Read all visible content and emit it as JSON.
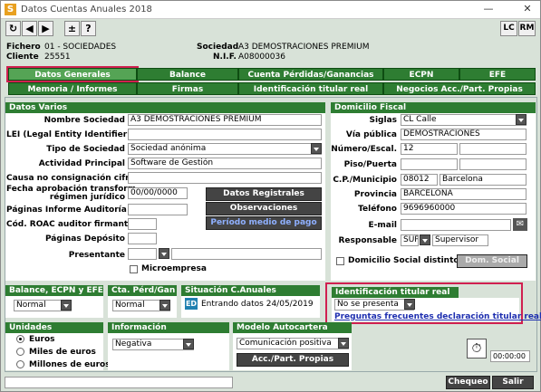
{
  "window": {
    "title": "Datos Cuentas Anuales 2018",
    "app_icon": "S",
    "lc": "LC",
    "rm": "RM"
  },
  "header": {
    "fichero_label": "Fichero",
    "fichero_value": "01 - SOCIEDADES",
    "cliente_label": "Cliente",
    "cliente_value": "25551",
    "sociedad_label": "Sociedad",
    "sociedad_value": "A3 DEMOSTRACIONES PREMIUM",
    "nif_label": "N.I.F.",
    "nif_value": "A08000036"
  },
  "tabs_row1": [
    "Datos Generales",
    "Balance",
    "Cuenta Pérdidas/Ganancias",
    "ECPN",
    "EFE"
  ],
  "tabs_row2": [
    "Memoria / Informes",
    "Firmas",
    "Identificación titular real",
    "Negocios Acc./Part. Propias"
  ],
  "datos_varios": {
    "title": "Datos Varios",
    "nombre_label": "Nombre Sociedad",
    "nombre_value": "A3 DEMOSTRACIONES PREMIUM",
    "lei_label": "LEI (Legal Entity Identifier)",
    "tipo_label": "Tipo de Sociedad",
    "tipo_value": "Sociedad anónima",
    "actividad_label": "Actividad Principal",
    "actividad_value": "Software de Gestión",
    "causa_label": "Causa no consignación cifras",
    "fecha_label1": "Fecha aprobación transform.",
    "fecha_label2": "régimen jurídico",
    "fecha_value": "00/00/0000",
    "paginas_inf_label": "Páginas Informe Auditoría",
    "roac_label": "Cód. ROAC auditor firmante",
    "paginas_dep_label": "Páginas Depósito",
    "presentante_label": "Presentante",
    "microempresa_label": "Microempresa",
    "btn_datos_registrales": "Datos Registrales",
    "btn_observaciones": "Observaciones",
    "btn_periodo": "Período medio de pago"
  },
  "domicilio": {
    "title": "Domicilio Fiscal",
    "siglas_label": "Siglas",
    "siglas_value": "CL Calle",
    "via_label": "Vía pública",
    "via_value": "DEMOSTRACIONES",
    "numero_label": "Número/Escal.",
    "numero_value": "12",
    "piso_label": "Piso/Puerta",
    "cp_label": "C.P./Municipio",
    "cp_value": "08012",
    "municipio_value": "Barcelona",
    "provincia_label": "Provincia",
    "provincia_value": "BARCELONA",
    "telefono_label": "Teléfono",
    "telefono_value": "9696960000",
    "email_label": "E-mail",
    "responsable_label": "Responsable",
    "responsable_code": "SUP",
    "responsable_value": "Supervisor",
    "distinto_label": "Domicilio Social distinto",
    "btn_dom_social": "Dom. Social"
  },
  "balance_ecpn": {
    "title": "Balance, ECPN y EFE",
    "value": "Normal"
  },
  "cta_perd": {
    "title": "Cta. Pérd/Gan",
    "value": "Normal"
  },
  "situacion": {
    "title": "Situación C.Anuales",
    "badge": "ED",
    "value": "Entrando datos 24/05/2019"
  },
  "identificacion": {
    "title": "Identificación titular real",
    "value": "No se presenta",
    "link": "Preguntas frecuentes declaración titular real"
  },
  "unidades": {
    "title": "Unidades",
    "options": [
      "Euros",
      "Miles de euros",
      "Millones de euros"
    ],
    "selected": 0
  },
  "info_medio": {
    "title": "Información Medioambiental",
    "value": "Negativa"
  },
  "modelo": {
    "title": "Modelo Autocartera",
    "value": "Comunicación positiva",
    "btn": "Acc./Part. Propias"
  },
  "timer": {
    "value": "00:00:00"
  },
  "footer": {
    "chequeo": "Chequeo",
    "salir": "Salir"
  },
  "colors": {
    "accent": "#2e7d32",
    "highlight": "#d02050",
    "link": "#1e2fb0"
  }
}
